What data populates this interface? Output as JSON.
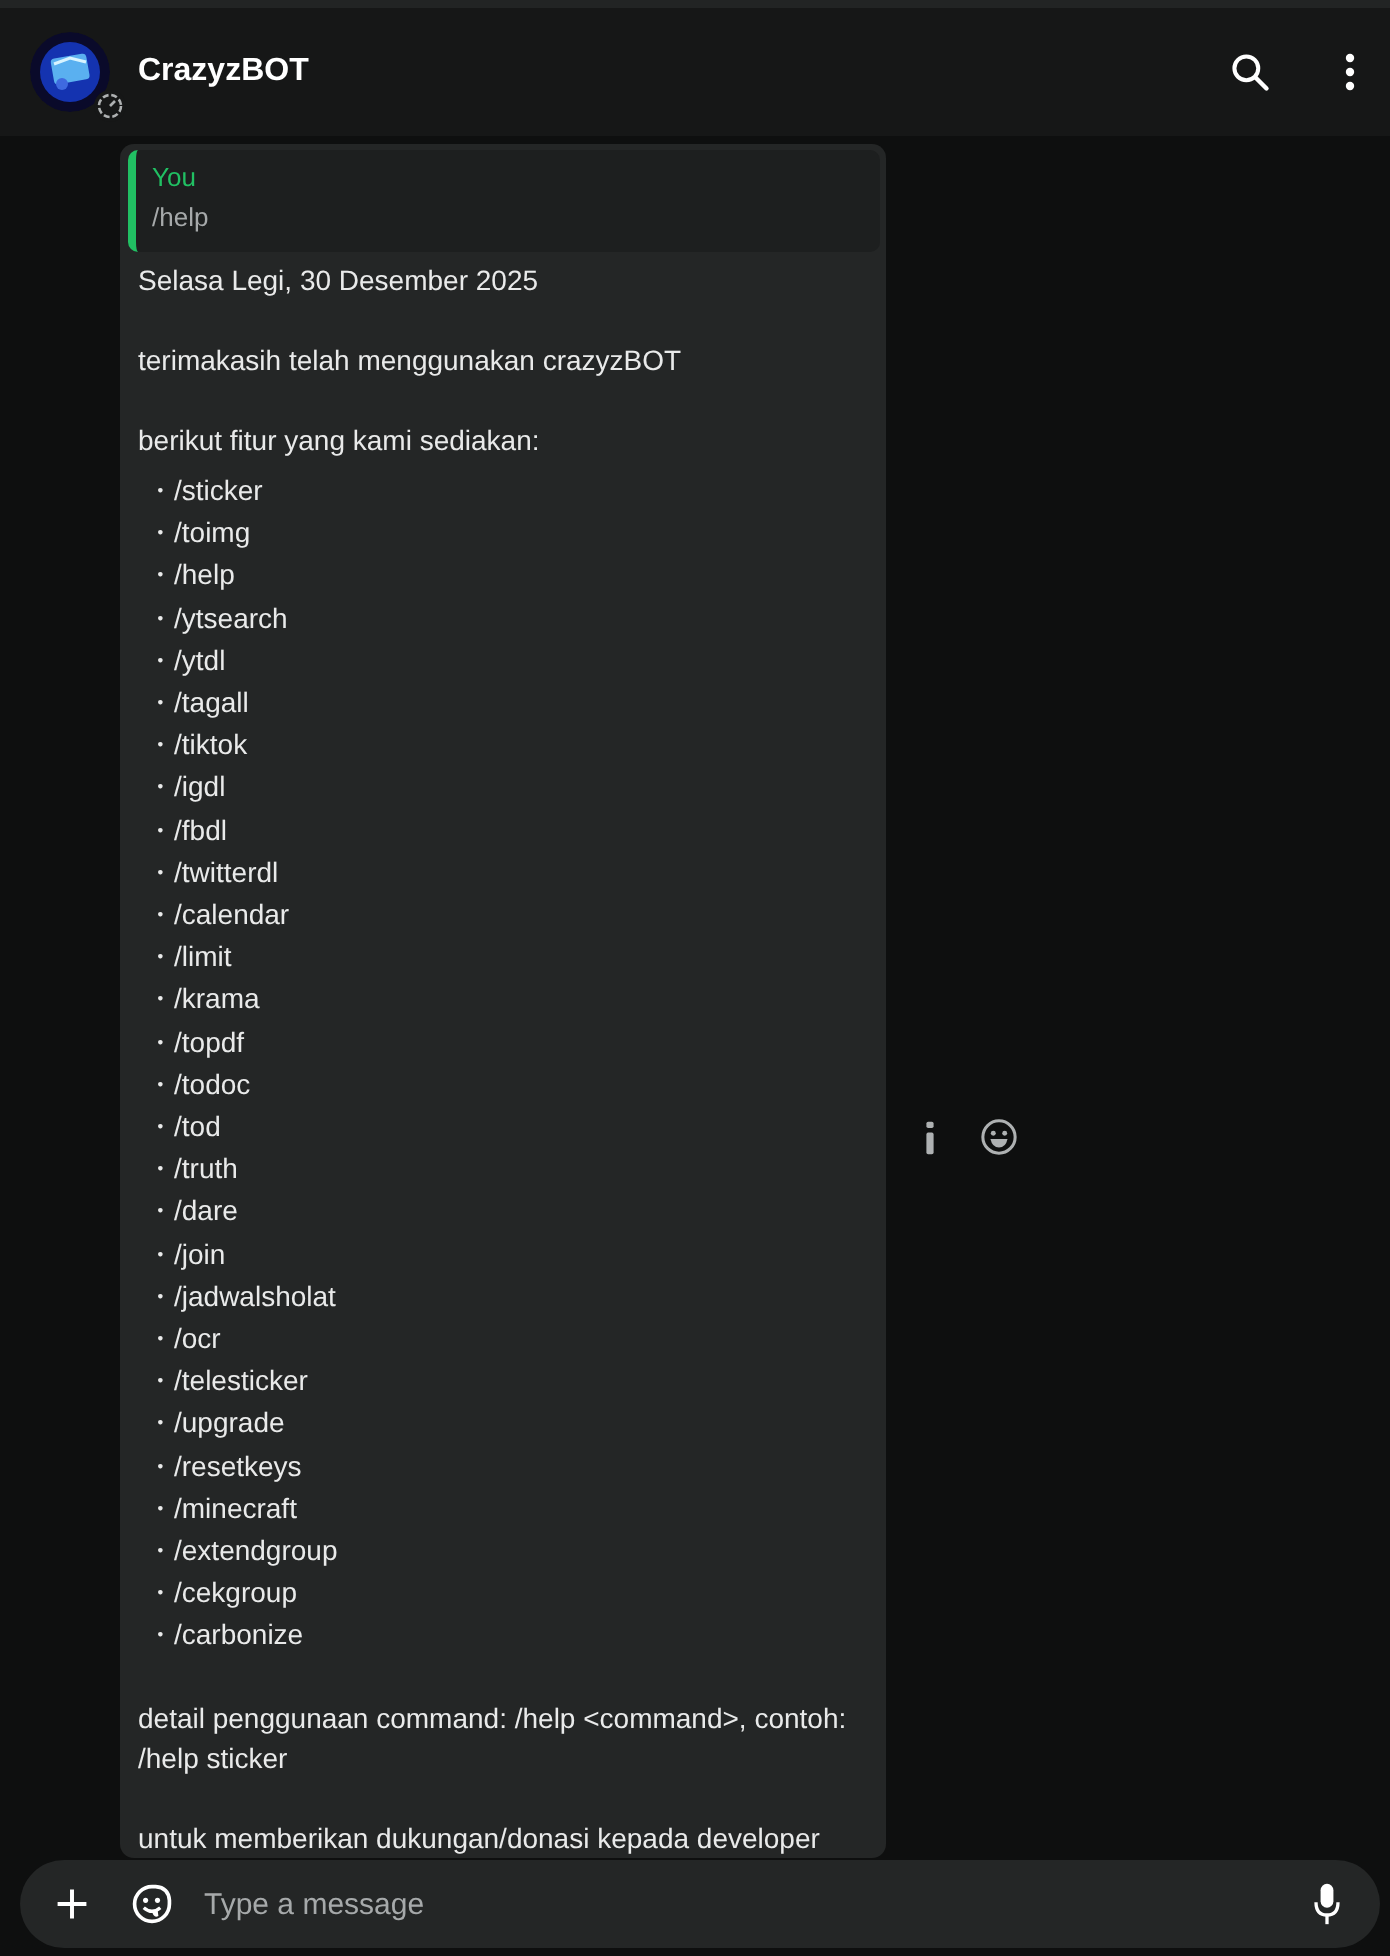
{
  "header": {
    "title": "CrazyzBOT"
  },
  "message": {
    "quote": {
      "author": "You",
      "text": "/help"
    },
    "date": "Selasa Legi, 30 Desember 2025",
    "intro": "terimakasih telah menggunakan crazyzBOT",
    "features_heading": "berikut fitur yang kami sediakan:",
    "commands": [
      "・/sticker",
      "・/toimg",
      "・/help",
      "・/ytsearch",
      "・/ytdl",
      "・/tagall",
      "・/tiktok",
      "・/igdl",
      "・/fbdl",
      "・/twitterdl",
      "・/calendar",
      "・/limit",
      "・/krama",
      "・/topdf",
      "・/todoc",
      "・/tod",
      "・/truth",
      "・/dare",
      "・/join",
      "・/jadwalsholat",
      "・/ocr",
      "・/telesticker",
      "・/upgrade",
      "・/resetkeys",
      "・/minecraft",
      "・/extendgroup",
      "・/cekgroup",
      "・/carbonize"
    ],
    "detail": "detail penggunaan command: /help <command>, contoh: /help sticker",
    "support": "untuk memberikan dukungan/donasi kepada developer"
  },
  "composer": {
    "placeholder": "Type a message"
  }
}
